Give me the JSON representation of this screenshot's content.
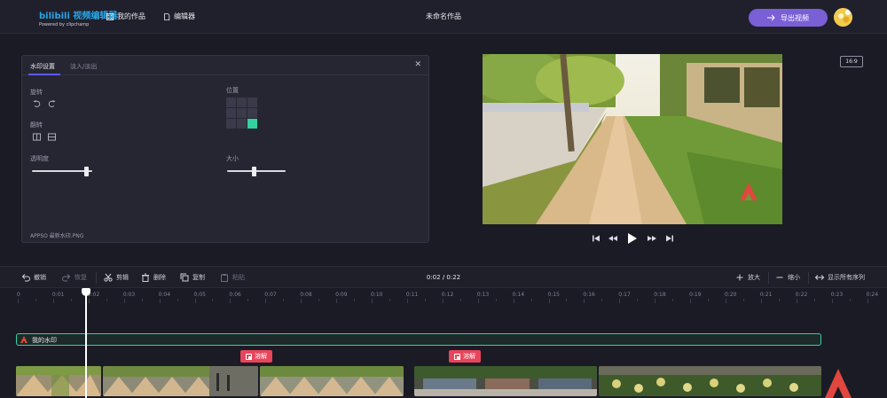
{
  "app": {
    "logo_text": "bilibili 视频编辑器",
    "logo_sub": "Powered by clipchamp"
  },
  "nav": {
    "my_works": "我的作品",
    "editor": "编辑器"
  },
  "document_title": "未命名作品",
  "export_label": "导出视频",
  "panel": {
    "tabs": [
      "水印设置",
      "淡入/淡出"
    ],
    "rotate_label": "旋转",
    "flip_label": "翻转",
    "opacity_label": "透明度",
    "position_label": "位置",
    "size_label": "大小",
    "opacity_value": 0.9,
    "size_value": 0.45,
    "position_selected": "bottom-right",
    "file_name": "APPSO 最新水印.PNG"
  },
  "aspect_ratio": "16:9",
  "toolbar": {
    "undo": "撤销",
    "redo": "恢复",
    "cut": "剪辑",
    "delete": "删除",
    "copy": "复制",
    "paste": "粘贴",
    "timecode": "0:02 / 0:22",
    "zoom_in": "放大",
    "zoom_out": "缩小",
    "show_all": "显示所有序列"
  },
  "ruler_ticks": [
    "0",
    "0:01",
    "0:02",
    "0:03",
    "0:04",
    "0:05",
    "0:06",
    "0:07",
    "0:08",
    "0:09",
    "0:10",
    "0:11",
    "0:12",
    "0:13",
    "0:14",
    "0:15",
    "0:16",
    "0:17",
    "0:18",
    "0:19",
    "0:20",
    "0:21",
    "0:22",
    "0:23",
    "0:24"
  ],
  "playhead_time": "0:02",
  "watermark_track_label": "我的水印",
  "transitions": [
    "溶解",
    "溶解"
  ],
  "colors": {
    "accent_purple": "#7a5fd6",
    "accent_green": "#34d1a0",
    "transition_red": "#e8455b",
    "background": "#1b1b26"
  }
}
